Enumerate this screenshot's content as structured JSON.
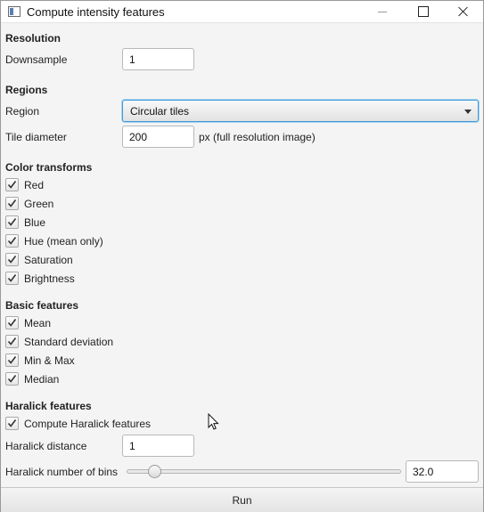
{
  "window": {
    "title": "Compute intensity features"
  },
  "resolution": {
    "heading": "Resolution",
    "downsample_label": "Downsample",
    "downsample_value": "1"
  },
  "regions": {
    "heading": "Regions",
    "region_label": "Region",
    "region_value": "Circular tiles",
    "tile_label": "Tile diameter",
    "tile_value": "200",
    "tile_unit": "px (full resolution image)"
  },
  "color_transforms": {
    "heading": "Color transforms",
    "items": [
      {
        "label": "Red",
        "checked": true
      },
      {
        "label": "Green",
        "checked": true
      },
      {
        "label": "Blue",
        "checked": true
      },
      {
        "label": "Hue (mean only)",
        "checked": true
      },
      {
        "label": "Saturation",
        "checked": true
      },
      {
        "label": "Brightness",
        "checked": true
      }
    ]
  },
  "basic_features": {
    "heading": "Basic features",
    "items": [
      {
        "label": "Mean",
        "checked": true
      },
      {
        "label": "Standard deviation",
        "checked": true
      },
      {
        "label": "Min & Max",
        "checked": true
      },
      {
        "label": "Median",
        "checked": true
      }
    ]
  },
  "haralick": {
    "heading": "Haralick features",
    "compute_label": "Compute Haralick features",
    "compute_checked": true,
    "distance_label": "Haralick distance",
    "distance_value": "1",
    "bins_label": "Haralick number of bins",
    "bins_value": "32.0"
  },
  "run_label": "Run"
}
